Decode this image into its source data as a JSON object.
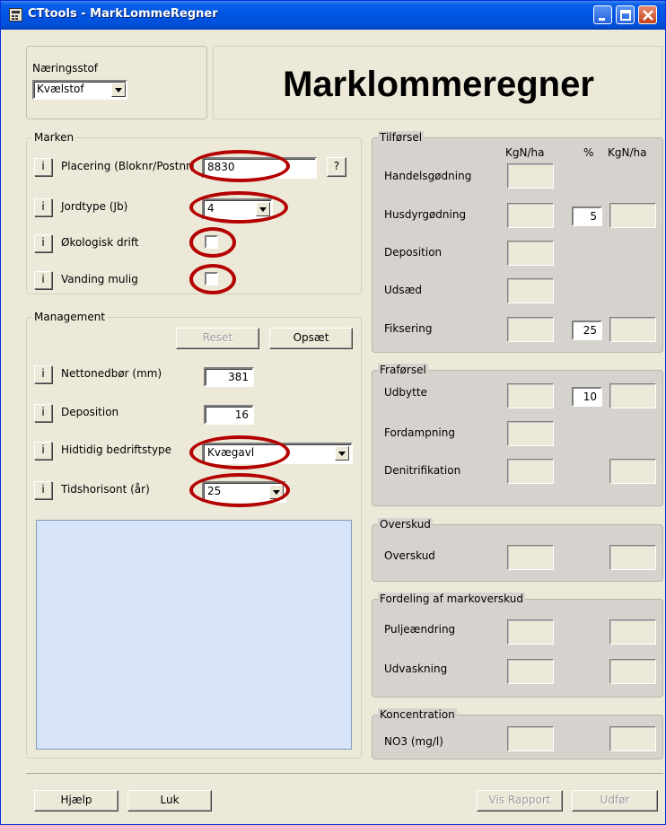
{
  "window": {
    "title": "CTtools - MarkLommeRegner",
    "controls": [
      "minimize",
      "maximize",
      "close"
    ]
  },
  "naeringsstof": {
    "label": "Næringsstof",
    "selected": "Kvælstof"
  },
  "heading": "Marklommeregner",
  "marken": {
    "legend": "Marken",
    "placering_label": "Placering (Bloknr/Postnr)",
    "placering_value": "8830",
    "help_label": "?",
    "jordtype_label": "Jordtype  (Jb)",
    "jordtype_value": "4",
    "okologisk_label": "Økologisk drift",
    "okologisk_checked": false,
    "vanding_label": "Vanding mulig",
    "vanding_checked": false,
    "info_label": "i"
  },
  "management": {
    "legend": "Management",
    "reset_label": "Reset",
    "opsaet_label": "Opsæt",
    "nettonedbor_label": "Nettonedbør (mm)",
    "nettonedbor_value": "381",
    "deposition_label": "Deposition",
    "deposition_value": "16",
    "bedriftstype_label": "Hidtidig bedriftstype",
    "bedriftstype_value": "Kvægavl",
    "tidshorisont_label": "Tidshorisont (år)",
    "tidshorisont_value": "25"
  },
  "tilforsel": {
    "legend": "Tilførsel",
    "col_kgn": "KgN/ha",
    "col_pct": "%",
    "col_kgn2": "KgN/ha",
    "rows": [
      {
        "label": "Handelsgødning"
      },
      {
        "label": "Husdyrgødning",
        "pct": "5"
      },
      {
        "label": "Deposition"
      },
      {
        "label": "Udsæd"
      },
      {
        "label": "Fiksering",
        "pct": "25"
      }
    ]
  },
  "fraforsel": {
    "legend": "Fraførsel",
    "rows": [
      {
        "label": "Udbytte",
        "pct": "10"
      },
      {
        "label": "Fordampning"
      },
      {
        "label": "Denitrifikation"
      }
    ]
  },
  "overskud": {
    "legend": "Overskud",
    "row_label": "Overskud"
  },
  "fordeling": {
    "legend": "Fordeling af markoverskud",
    "rows": [
      {
        "label": "Puljeændring"
      },
      {
        "label": "Udvaskning"
      }
    ]
  },
  "koncentration": {
    "legend": "Koncentration",
    "row_label": "NO3 (mg/l)"
  },
  "bottom": {
    "hjaelp_label": "Hjælp",
    "luk_label": "Luk",
    "rapport_label": "Vis Rapport",
    "udfor_label": "Udfør"
  },
  "colors": {
    "highlight_oval": "#b40000",
    "titlebar": "#0054e3",
    "window_bg": "#ece9d8",
    "panel_bg": "#d6d3ce",
    "notes_bg": "#d6e3f8"
  }
}
